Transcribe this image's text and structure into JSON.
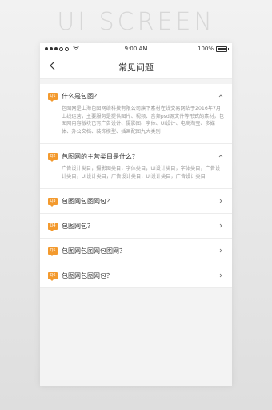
{
  "brand": {
    "title": "UI SCREEN"
  },
  "status_bar": {
    "time": "9:00 AM",
    "battery": "100%"
  },
  "nav": {
    "title": "常见问题"
  },
  "faq": [
    {
      "badge": "Q1",
      "question": "什么是包图？",
      "expanded": true,
      "answer": "包图网是上海包图网络科技有限公司旗下素材在线交易网站于2016年7月上线运营，主要服务是提供图片、视频、音频psd源文件等形式的素材，包图网内容版块已有广告设计、摄影图、字体、UI设计、电商淘宝、多媒体、办公文档、装饰模型、插画配图九大类别"
    },
    {
      "badge": "Q2",
      "question": "包图网的主营类目是什么？",
      "expanded": true,
      "answer": "广告设计类目，摄影图类目，字体类目，UI设计类目，字体类目，广告设计类目，UI设计类目，广告设计类目，UI设计类目，广告设计类目"
    },
    {
      "badge": "Q3",
      "question": "包图网包图网包？",
      "expanded": false,
      "answer": ""
    },
    {
      "badge": "Q4",
      "question": "包图网包？",
      "expanded": false,
      "answer": ""
    },
    {
      "badge": "Q5",
      "question": "包图网包图网包图网？",
      "expanded": false,
      "answer": ""
    },
    {
      "badge": "Q6",
      "question": "包图网包图网包？",
      "expanded": false,
      "answer": ""
    }
  ],
  "icons": {
    "back": "chevron-left-icon",
    "expanded": "chevron-up-icon",
    "collapsed": "chevron-right-icon",
    "wifi": "wifi-icon",
    "battery": "battery-icon"
  },
  "colors": {
    "accent": "#f39a2e",
    "question_text": "#333333",
    "answer_text": "#999999",
    "background": "#f3f3f3"
  }
}
